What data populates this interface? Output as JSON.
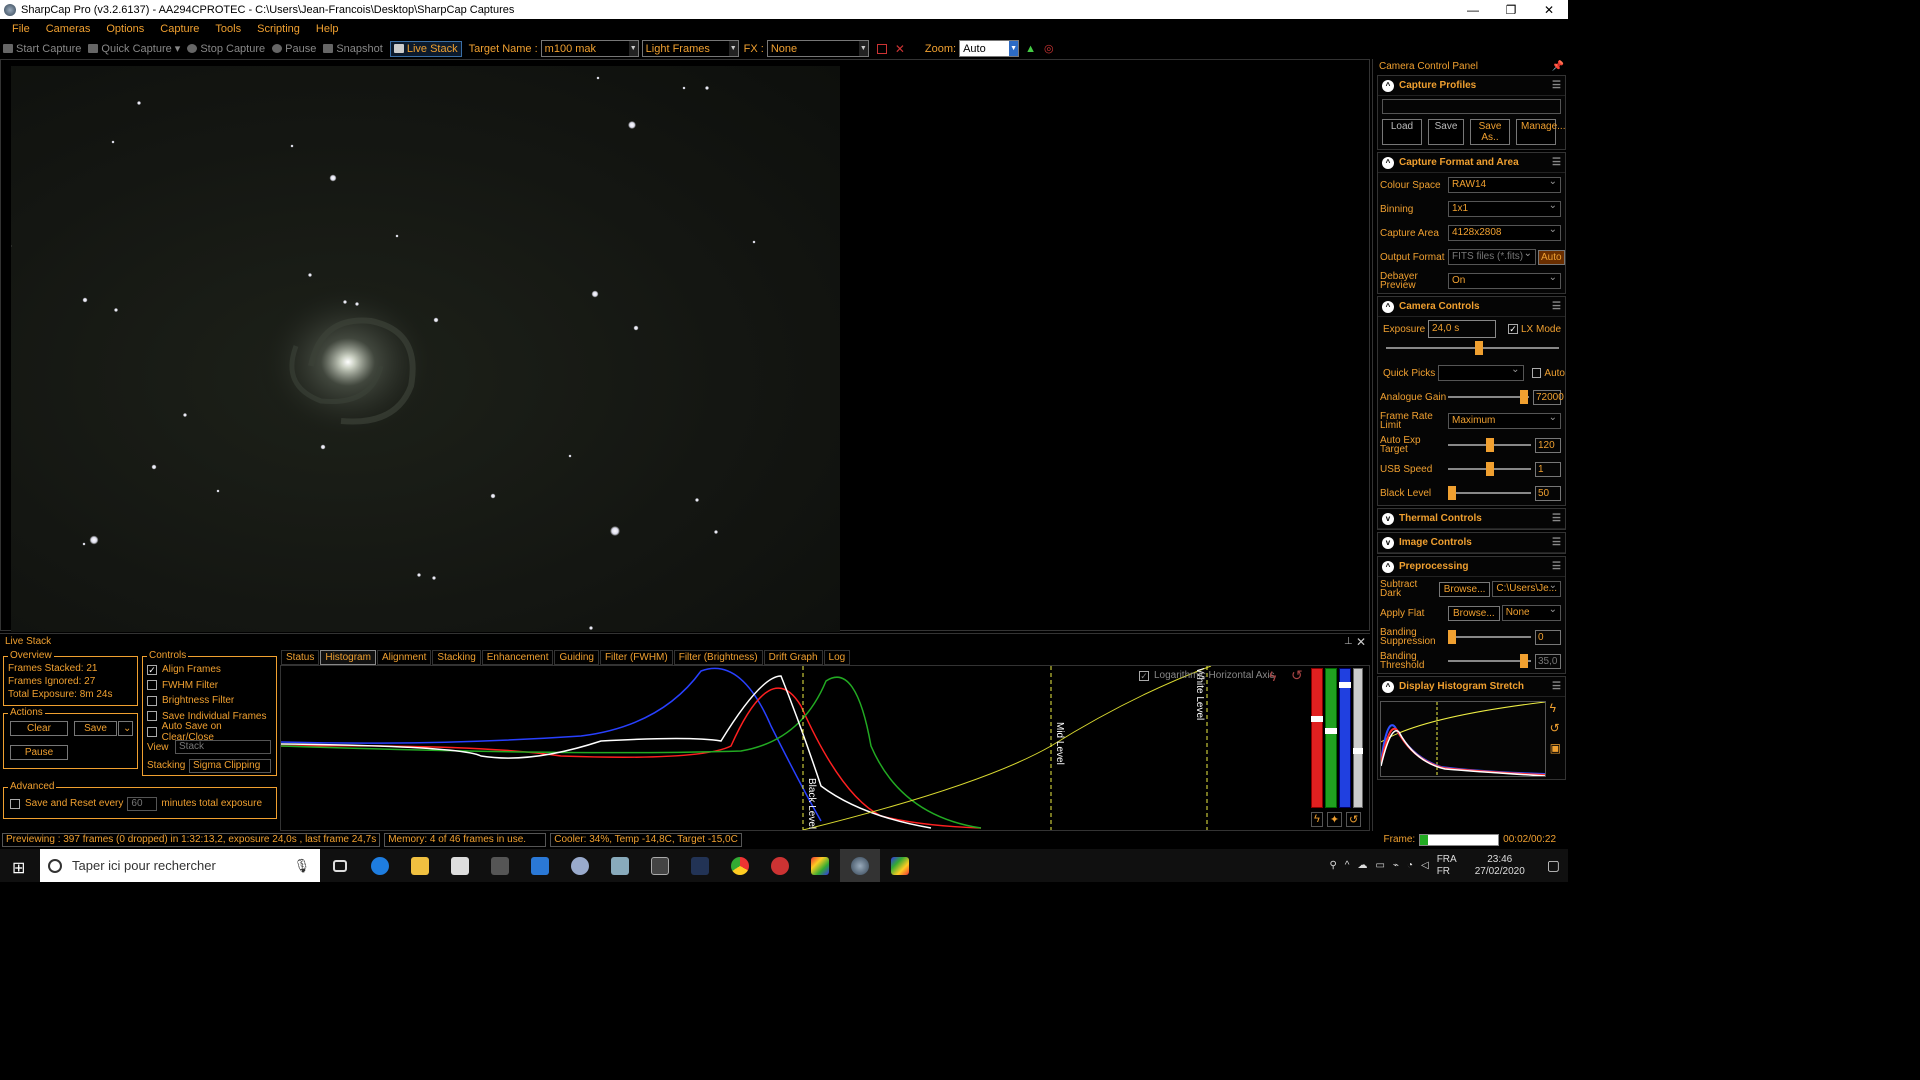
{
  "window": {
    "title": "SharpCap Pro (v3.2.6137) - AA294CPROTEC - C:\\Users\\Jean-Francois\\Desktop\\SharpCap Captures"
  },
  "menu": [
    "File",
    "Cameras",
    "Options",
    "Capture",
    "Tools",
    "Scripting",
    "Help"
  ],
  "toolbar": {
    "start_capture": "Start Capture",
    "quick_capture": "Quick Capture",
    "stop_capture": "Stop Capture",
    "pause": "Pause",
    "snapshot": "Snapshot",
    "live_stack": "Live Stack",
    "target_label": "Target Name :",
    "target_value": "m100 mak",
    "frame_type": "Light Frames",
    "fx_label": "FX :",
    "fx_value": "None",
    "zoom_label": "Zoom:",
    "zoom_value": "Auto"
  },
  "panel": {
    "title": "Camera Control Panel",
    "capture_profiles": {
      "title": "Capture Profiles",
      "load": "Load",
      "save": "Save",
      "save_as": "Save As..",
      "manage": "Manage..."
    },
    "capture_format": {
      "title": "Capture Format and Area",
      "colour_space_label": "Colour Space",
      "colour_space": "RAW14",
      "binning_label": "Binning",
      "binning": "1x1",
      "capture_area_label": "Capture Area",
      "capture_area": "4128x2808",
      "output_format_label": "Output Format",
      "output_format": "FITS files (*.fits)",
      "auto": "Auto",
      "debayer_label": "Debayer Preview",
      "debayer": "On"
    },
    "camera_controls": {
      "title": "Camera Controls",
      "exposure_label": "Exposure",
      "exposure": "24,0 s",
      "lx_mode": "LX Mode",
      "quick_picks_label": "Quick Picks",
      "auto": "Auto",
      "gain_label": "Analogue Gain",
      "gain": "72000",
      "frame_rate_label": "Frame Rate Limit",
      "frame_rate": "Maximum",
      "auto_exp_label": "Auto Exp Target",
      "auto_exp": "120",
      "usb_label": "USB Speed",
      "usb": "1",
      "black_label": "Black Level",
      "black": "50"
    },
    "thermal": {
      "title": "Thermal Controls"
    },
    "image_controls": {
      "title": "Image Controls"
    },
    "preprocessing": {
      "title": "Preprocessing",
      "dark_label": "Subtract Dark",
      "browse": "Browse...",
      "dark_path": "C:\\Users\\Je...",
      "flat_label": "Apply Flat",
      "flat_value": "None",
      "banding_supp_label": "Banding Suppression",
      "banding_supp": "0",
      "banding_thr_label": "Banding Threshold",
      "banding_thr": "35,0"
    },
    "histogram_stretch": {
      "title": "Display Histogram Stretch"
    }
  },
  "live_stack": {
    "title": "Live Stack",
    "overview": {
      "title": "Overview",
      "frames_stacked": "Frames Stacked:  21",
      "frames_ignored": "Frames Ignored:  27",
      "total_exposure": "Total Exposure:   8m 24s"
    },
    "actions": {
      "title": "Actions",
      "clear": "Clear",
      "save": "Save",
      "pause": "Pause"
    },
    "controls": {
      "title": "Controls",
      "align": "Align Frames",
      "fwhm": "FWHM Filter",
      "brightness": "Brightness Filter",
      "save_individual": "Save Individual Frames",
      "auto_save": "Auto Save on Clear/Close",
      "view_label": "View",
      "view": "Stack",
      "stacking_label": "Stacking",
      "stacking": "Sigma Clipping"
    },
    "advanced": {
      "title": "Advanced",
      "save_reset": "Save and Reset every",
      "minutes": "60",
      "minutes_label": "minutes total exposure"
    },
    "tabs": [
      "Status",
      "Histogram",
      "Alignment",
      "Stacking",
      "Enhancement",
      "Guiding",
      "Filter (FWHM)",
      "Filter (Brightness)",
      "Drift Graph",
      "Log"
    ],
    "hist": {
      "log_axis": "Logarithmic Horizontal Axis",
      "black_level": "Black Level",
      "mid_level": "Mid Level",
      "white_level": "White Level"
    }
  },
  "status": {
    "preview": "Previewing : 397 frames (0 dropped) in 1:32:13,2, exposure 24,0s , last frame 24,7s",
    "memory": "Memory: 4 of 46 frames in use.",
    "cooler": "Cooler: 34%, Temp -14,8C, Target -15,0C",
    "frame_label": "Frame:",
    "frame_time": "00:02/00:22"
  },
  "taskbar": {
    "search": "Taper ici pour rechercher",
    "lang1": "FRA",
    "lang2": "FR",
    "time": "23:46",
    "date": "27/02/2020"
  }
}
